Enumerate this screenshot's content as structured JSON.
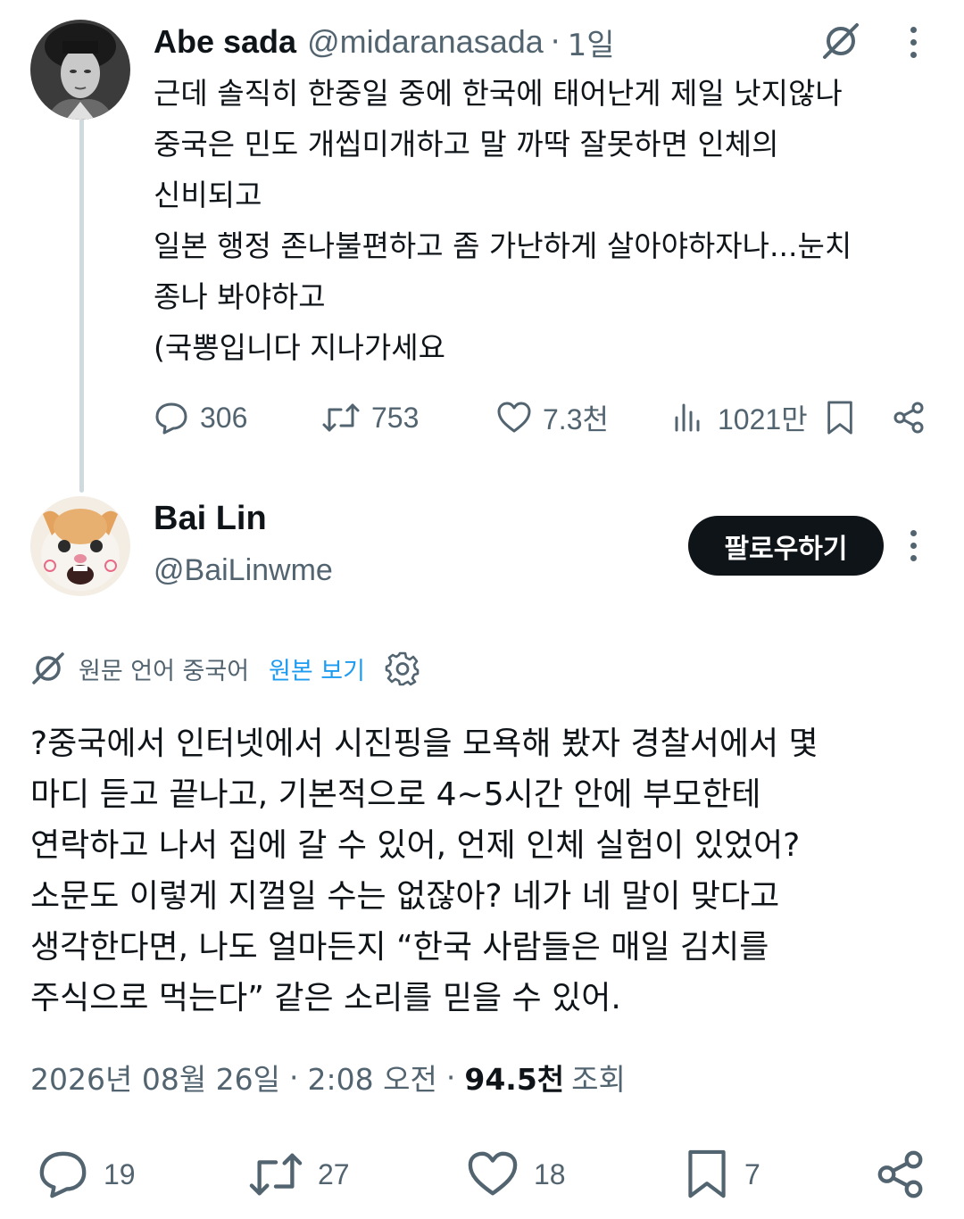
{
  "parent_tweet": {
    "name": "Abe sada",
    "handle": "@midaranasada",
    "separator": "·",
    "time": "1일",
    "text_lines": [
      "근데 솔직히 한중일 중에 한국에 태어난게 제일 낫지않나",
      "중국은 민도 개씹미개하고 말 까딱 잘못하면 인체의",
      "신비되고",
      "일본 행정 존나불편하고 좀 가난하게 살아야하자나...눈치",
      "종나 봐야하고",
      "(국뽕입니다 지나가세요"
    ],
    "actions": {
      "replies": "306",
      "reposts": "753",
      "likes": "7.3천",
      "views": "1021만"
    }
  },
  "reply_tweet": {
    "name": "Bai Lin",
    "handle": "@BaiLinwme",
    "follow_label": "팔로우하기",
    "translation": {
      "source_language": "원문 언어 중국어",
      "show_original": "원본 보기"
    },
    "text_lines": [
      "?중국에서 인터넷에서 시진핑을 모욕해 봤자 경찰서에서 몇",
      "마디 듣고 끝나고, 기본적으로 4~5시간 안에 부모한테",
      "연락하고 나서 집에 갈 수 있어, 언제 인체 실험이 있었어?",
      "소문도 이렇게 지껄일 수는 없잖아? 네가 네 말이 맞다고",
      "생각한다면, 나도 얼마든지 “한국 사람들은 매일 김치를",
      "주식으로 먹는다” 같은 소리를 믿을 수 있어."
    ],
    "meta": {
      "date": "2026년 08월 26일",
      "time": "2:08 오전",
      "separator": "·",
      "views_count": "94.5천",
      "views_label": "조회"
    },
    "actions": {
      "replies": "19",
      "reposts": "27",
      "likes": "18",
      "bookmarks": "7"
    }
  },
  "icons": [
    "grok-icon",
    "more-icon",
    "reply-icon",
    "repost-icon",
    "like-icon",
    "views-icon",
    "bookmark-icon",
    "share-icon",
    "translate-icon",
    "gear-icon"
  ],
  "colors": {
    "text": "#0f1419",
    "secondary": "#536471",
    "link": "#1d9bf0",
    "thread_line": "#cfd9de",
    "button_bg": "#0f1419"
  }
}
